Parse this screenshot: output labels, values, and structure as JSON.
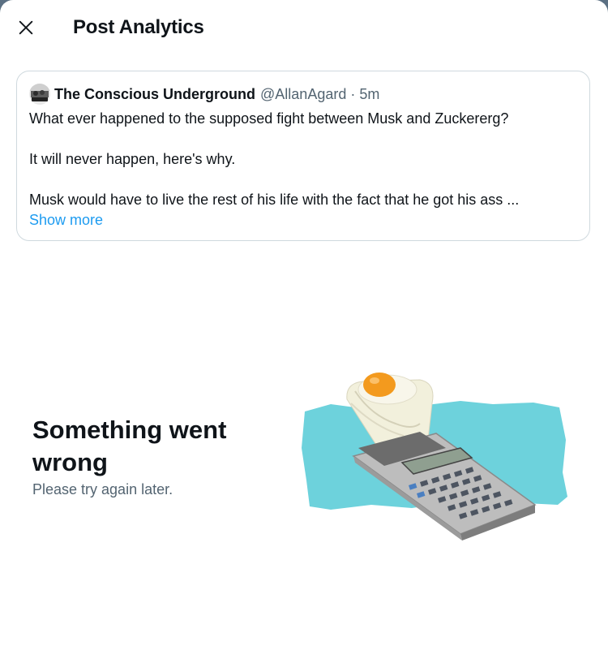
{
  "header": {
    "title": "Post Analytics",
    "close_icon": "close-icon"
  },
  "quoted_post": {
    "author_name": "The Conscious Underground",
    "handle": "@AllanAgard",
    "separator": "·",
    "time": "5m",
    "lines": [
      "What ever happened to the supposed fight between Musk and Zuckererg?",
      "It will never happen, here's why.",
      "Musk would have to live the rest of his life with the fact that he got his ass ..."
    ],
    "show_more": "Show more"
  },
  "error": {
    "title": "Something went wrong",
    "subtitle": "Please try again later.",
    "illustration_icon": "calculator-with-egg-illustration"
  },
  "colors": {
    "text_primary": "#0f1419",
    "text_secondary": "#536471",
    "link": "#1d9bf0",
    "border": "#cfd9de",
    "illustration_bg": "#6dd2dc"
  }
}
